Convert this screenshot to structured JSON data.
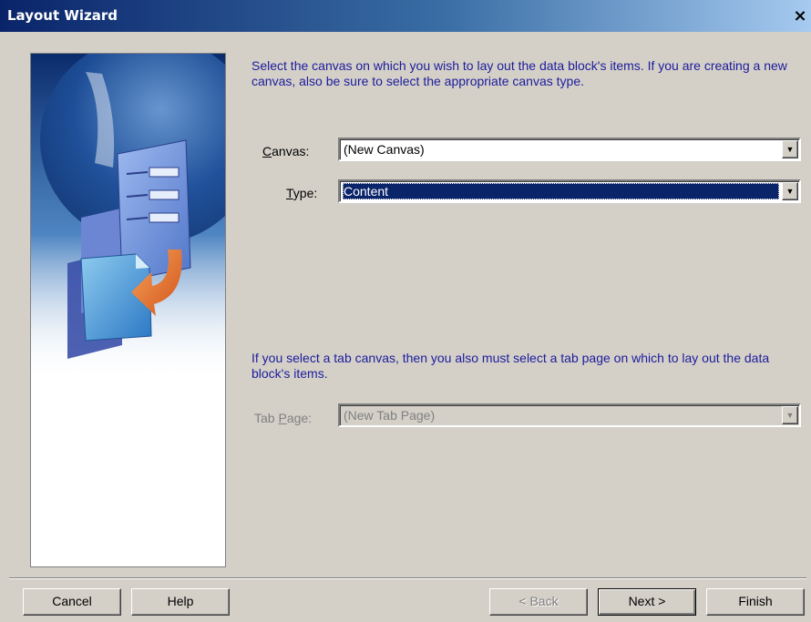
{
  "window": {
    "title": "Layout Wizard",
    "close_glyph": "×"
  },
  "intro_text": "Select the canvas on which you wish to lay out the data block's items. If you are creating a new canvas, also be sure to select the appropriate canvas type.",
  "canvas": {
    "label_accel": "C",
    "label_rest": "anvas:",
    "value": "(New Canvas)"
  },
  "type": {
    "label_accel": "T",
    "label_rest": "ype:",
    "value": "Content"
  },
  "tab_text": "If you select a tab canvas, then you also must select a tab page on which to lay out the data block's items.",
  "tab_page": {
    "label_pre": "Tab ",
    "label_accel": "P",
    "label_rest": "age:",
    "value": "(New Tab Page)"
  },
  "buttons": {
    "cancel": "Cancel",
    "help": "Help",
    "back": "< Back",
    "next": "Next >",
    "finish": "Finish"
  },
  "colors": {
    "title_bar": "#0a246a",
    "instruction_text": "#1c1c9c",
    "selection": "#0a246a",
    "face": "#d4d0c8"
  },
  "icons": [
    "close-icon",
    "dropdown-arrow-icon",
    "wizard-illustration"
  ]
}
